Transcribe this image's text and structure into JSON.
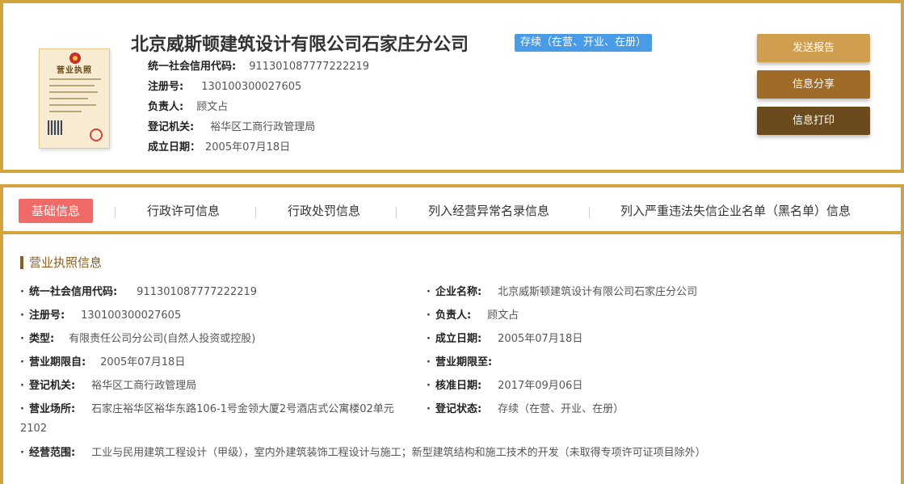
{
  "header": {
    "company_name": "北京威斯顿建筑设计有限公司石家庄分公司",
    "status": "存续（在营、开业、在册）",
    "license_image_title": "营业执照",
    "info": [
      {
        "label": "统一社会信用代码:",
        "value": "911301087777222219"
      },
      {
        "label": "注册号:",
        "value": "130100300027605"
      },
      {
        "label": "负责人:",
        "value": "顾文占"
      },
      {
        "label": "登记机关:",
        "value": "裕华区工商行政管理局"
      },
      {
        "label": "成立日期：",
        "value": "2005年07月18日"
      }
    ],
    "buttons": {
      "report": "发送报告",
      "share": "信息分享",
      "print": "信息打印"
    }
  },
  "tabs": [
    "基础信息",
    "行政许可信息",
    "行政处罚信息",
    "列入经营异常名录信息",
    "列入严重违法失信企业名单（黑名单）信息"
  ],
  "section_title": "营业执照信息",
  "fields": {
    "credit_code": {
      "label": "统一社会信用代码:",
      "value": "911301087777222219"
    },
    "enterprise_name": {
      "label": "企业名称:",
      "value": "北京威斯顿建筑设计有限公司石家庄分公司"
    },
    "reg_no": {
      "label": "注册号:",
      "value": "130100300027605"
    },
    "legal_person": {
      "label": "负责人:",
      "value": "顾文占"
    },
    "type": {
      "label": "类型:",
      "value": "有限责任公司分公司(自然人投资或控股)"
    },
    "established": {
      "label": "成立日期:",
      "value": "2005年07月18日"
    },
    "term_from": {
      "label": "营业期限自:",
      "value": "2005年07月18日"
    },
    "term_to": {
      "label": "营业期限至:",
      "value": ""
    },
    "authority": {
      "label": "登记机关:",
      "value": "裕华区工商行政管理局"
    },
    "approved": {
      "label": "核准日期:",
      "value": "2017年09月06日"
    },
    "address": {
      "label": "营业场所:",
      "value": "石家庄裕华区裕华东路106-1号金领大厦2号酒店式公寓楼02单元",
      "value_cont": "2102"
    },
    "reg_status": {
      "label": "登记状态:",
      "value": "存续（在营、开业、在册）"
    },
    "scope": {
      "label": "经营范围:",
      "value": "工业与民用建筑工程设计（甲级），室内外建筑装饰工程设计与施工；新型建筑结构和施工技术的开发（未取得专项许可证项目除外）"
    }
  },
  "colors": {
    "border": "#d3a33d",
    "badge": "#4a9be6",
    "active_tab": "#f06a68",
    "btn_report": "#cf9e4f",
    "btn_share": "#a06a27",
    "btn_print": "#6b4a1e"
  }
}
